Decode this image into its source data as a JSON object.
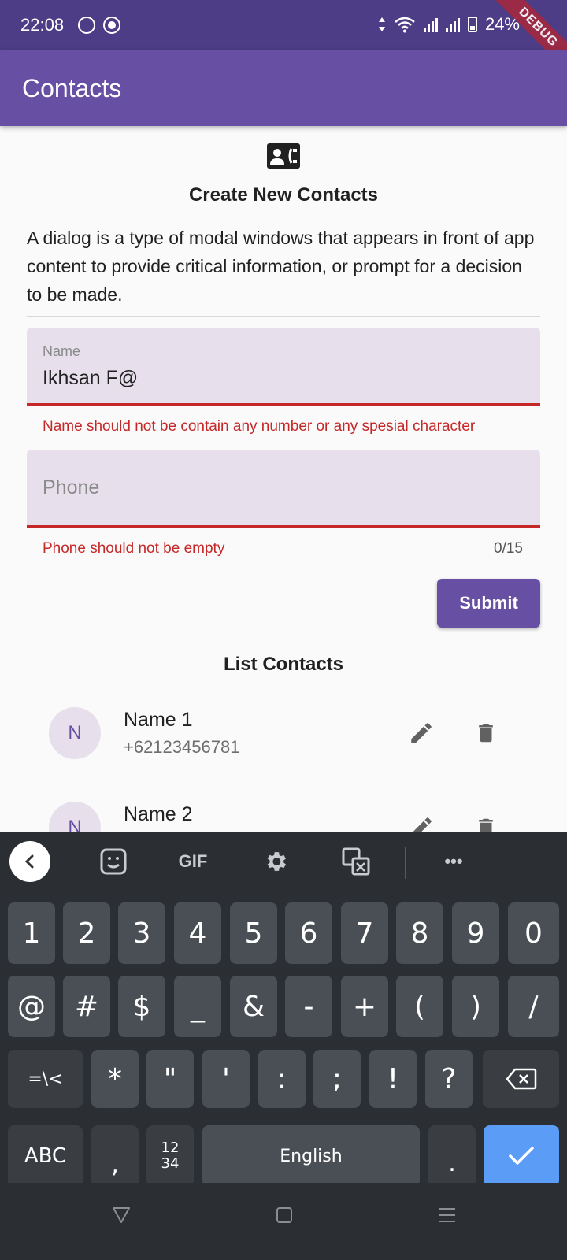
{
  "status_bar": {
    "time": "22:08",
    "battery": "24%",
    "debug_ribbon": "DEBUG"
  },
  "app_bar": {
    "title": "Contacts"
  },
  "form": {
    "heading": "Create New Contacts",
    "description": "A dialog is a type of modal windows that appears in front of app content to provide critical information, or prompt for a decision to be made.",
    "name_field": {
      "label": "Name",
      "value": "Ikhsan F@",
      "error": "Name should not be contain any number or any spesial character"
    },
    "phone_field": {
      "placeholder": "Phone",
      "error": "Phone should not be empty",
      "counter": "0/15"
    },
    "submit_label": "Submit"
  },
  "list": {
    "heading": "List Contacts",
    "items": [
      {
        "avatar": "N",
        "name": "Name 1",
        "phone": "+62123456781"
      },
      {
        "avatar": "N",
        "name": "Name 2",
        "phone": ""
      }
    ]
  },
  "keyboard": {
    "toolbar": {
      "gif_label": "GIF",
      "more_label": "•••"
    },
    "row1": [
      "1",
      "2",
      "3",
      "4",
      "5",
      "6",
      "7",
      "8",
      "9",
      "0"
    ],
    "row2": [
      "@",
      "#",
      "$",
      "_",
      "&",
      "-",
      "+",
      "(",
      ")",
      "/"
    ],
    "row3": [
      "=\\<",
      "*",
      "\"",
      "'",
      ":",
      ";",
      "!",
      "?"
    ],
    "row4": {
      "abc": "ABC",
      "comma": ",",
      "num": "12\n34",
      "space": "English",
      "period": "."
    }
  },
  "colors": {
    "primary": "#6750a4",
    "status_bar": "#4c3d86",
    "error": "#c62828",
    "field_fill": "#e7e0ec",
    "keyboard_bg": "#2b2f33",
    "key_bg": "#4a4f55",
    "enter_key": "#5b9cf6"
  }
}
